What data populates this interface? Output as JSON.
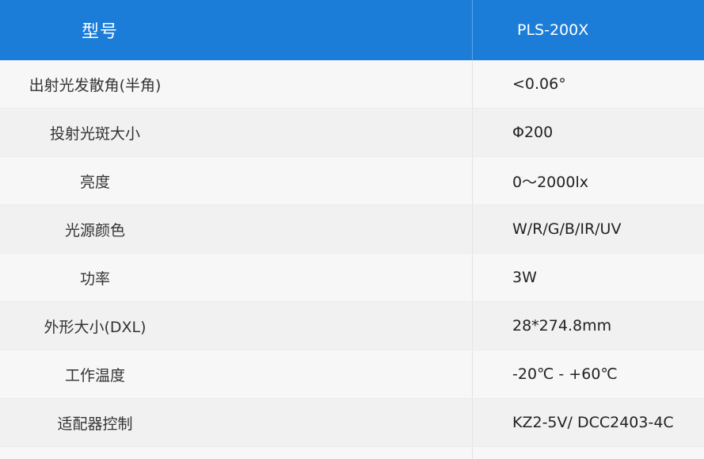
{
  "table": {
    "header": {
      "label": "型号",
      "value": "PLS-200X"
    },
    "rows": [
      {
        "label": "出射光发散角(半角)",
        "value": "<0.06°"
      },
      {
        "label": "投射光斑大小",
        "value": "Φ200"
      },
      {
        "label": "亮度",
        "value": "0～2000lx"
      },
      {
        "label": "光源颜色",
        "value": "W/R/G/B/IR/UV"
      },
      {
        "label": "功率",
        "value": "3W"
      },
      {
        "label": "外形大小(DXL)",
        "value": "28*274.8mm"
      },
      {
        "label": "工作温度",
        "value": "-20℃ - +60℃"
      },
      {
        "label": "适配器控制",
        "value": "KZ2-5V/ DCC2403-4C"
      }
    ]
  },
  "colors": {
    "header_bg": "#1c7dd8",
    "row_odd_bg": "#f7f7f7",
    "row_even_bg": "#f1f1f1"
  }
}
